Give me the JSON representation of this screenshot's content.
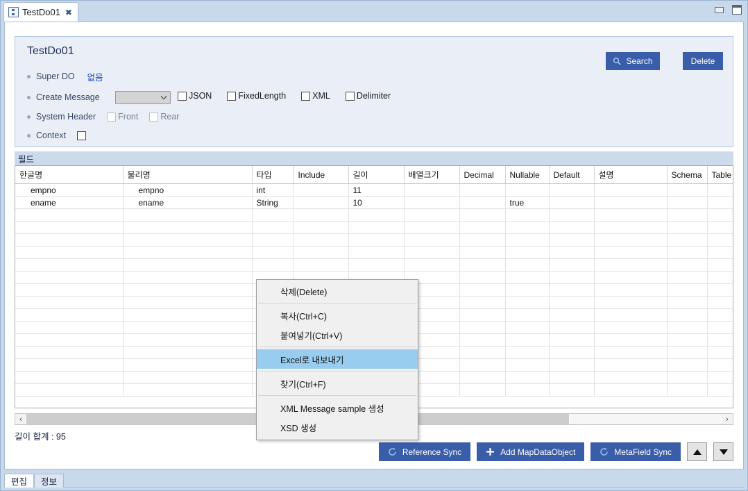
{
  "window": {
    "tab": {
      "title": "TestDo01",
      "icon": "data-object-icon",
      "close": "✖"
    },
    "minimize": "minimize-button",
    "maximize": "maximize-button"
  },
  "form": {
    "title": "TestDo01",
    "super_do": {
      "label": "Super DO",
      "value": "없음"
    },
    "create_message": {
      "label": "Create Message",
      "selected": "",
      "options": [
        ""
      ],
      "checkboxes": [
        {
          "label": "JSON",
          "checked": false
        },
        {
          "label": "FixedLength",
          "checked": false
        },
        {
          "label": "XML",
          "checked": false
        },
        {
          "label": "Delimiter",
          "checked": false
        }
      ]
    },
    "system_header": {
      "label": "System Header",
      "checkboxes": [
        {
          "label": "Front",
          "checked": false,
          "disabled": true
        },
        {
          "label": "Rear",
          "checked": false,
          "disabled": true
        }
      ]
    },
    "context": {
      "label": "Context",
      "checked": false
    },
    "search_button": {
      "label": "Search",
      "icon": "search-icon"
    },
    "delete_button": {
      "label": "Delete"
    }
  },
  "field_section": {
    "label": "필드",
    "columns": [
      "한글명",
      "물리명",
      "타입",
      "Include",
      "길이",
      "배열크기",
      "Decimal",
      "Nullable",
      "Default",
      "설명",
      "Schema",
      "Table"
    ],
    "rows": [
      {
        "korean_name": "empno",
        "physical_name": "empno",
        "type": "int",
        "include": "",
        "length": "11",
        "array_size": "",
        "decimal": "",
        "nullable": "",
        "default": "",
        "description": "",
        "schema": "",
        "table": ""
      },
      {
        "korean_name": "ename",
        "physical_name": "ename",
        "type": "String",
        "include": "",
        "length": "10",
        "array_size": "",
        "decimal": "",
        "nullable": "true",
        "default": "",
        "description": "",
        "schema": "",
        "table": ""
      }
    ],
    "empty_row_count": 15,
    "length_total": "길이 합계 : 95"
  },
  "scrollbar": {
    "left_arrow": "‹",
    "right_arrow": "›",
    "thumb_percent": 78
  },
  "actions": {
    "reference_sync": {
      "label": "Reference Sync",
      "icon": "refresh-icon"
    },
    "add_mapdataobject": {
      "label": "Add MapDataObject",
      "icon": "plus-icon"
    },
    "metafield_sync": {
      "label": "MetaField Sync",
      "icon": "refresh-icon"
    },
    "move_up": "move-up-button",
    "move_down": "move-down-button"
  },
  "bottom_tabs": [
    {
      "label": "편집",
      "active": true
    },
    {
      "label": "정보",
      "active": false
    }
  ],
  "context_menu": {
    "items": [
      {
        "label": "삭제(Delete)",
        "selected": false,
        "separator_after": true
      },
      {
        "label": "복사(Ctrl+C)",
        "selected": false,
        "separator_after": false
      },
      {
        "label": "붙여넣기(Ctrl+V)",
        "selected": false,
        "separator_after": true
      },
      {
        "label": "Excel로 내보내기",
        "selected": true,
        "separator_after": true
      },
      {
        "label": "찾기(Ctrl+F)",
        "selected": false,
        "separator_after": true
      },
      {
        "label": "XML Message sample 생성",
        "selected": false,
        "separator_after": false
      },
      {
        "label": "XSD 생성",
        "selected": false,
        "separator_after": false
      }
    ]
  },
  "colors": {
    "accent_blue": "#3a5da9",
    "link_blue": "#1c46b8",
    "panel_bg": "#e9eef7",
    "window_bg": "#c9d9ec",
    "band_bg": "#ccdaec",
    "menu_highlight": "#99cdf0"
  }
}
